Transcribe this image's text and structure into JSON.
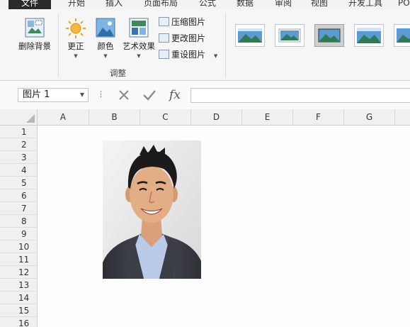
{
  "menu": {
    "tabs": [
      "文件",
      "开始",
      "插入",
      "页面布局",
      "公式",
      "数据",
      "审阅",
      "视图",
      "开发工具",
      "PO"
    ]
  },
  "ribbon": {
    "remove_bg": "删除背景",
    "corrections": "更正",
    "color": "颜色",
    "artistic": "艺术效果",
    "compress": "压缩图片",
    "change": "更改图片",
    "reset": "重设图片",
    "group_adjust": "调整"
  },
  "formula_bar": {
    "name_box": "图片 1",
    "fx": "fx",
    "value": ""
  },
  "sheet": {
    "columns": [
      "A",
      "B",
      "C",
      "D",
      "E",
      "F",
      "G"
    ],
    "rows": [
      "1",
      "2",
      "3",
      "4",
      "5",
      "6",
      "7",
      "8",
      "9",
      "10",
      "11",
      "12",
      "13",
      "14",
      "15",
      "16"
    ]
  },
  "colors": {
    "file_tab": "#2a2a2a",
    "ribbon_bg": "#f6f6f6",
    "header_bg": "#f0f0f0",
    "suit": "#3b3f45",
    "shirt": "#b9cbe8"
  }
}
